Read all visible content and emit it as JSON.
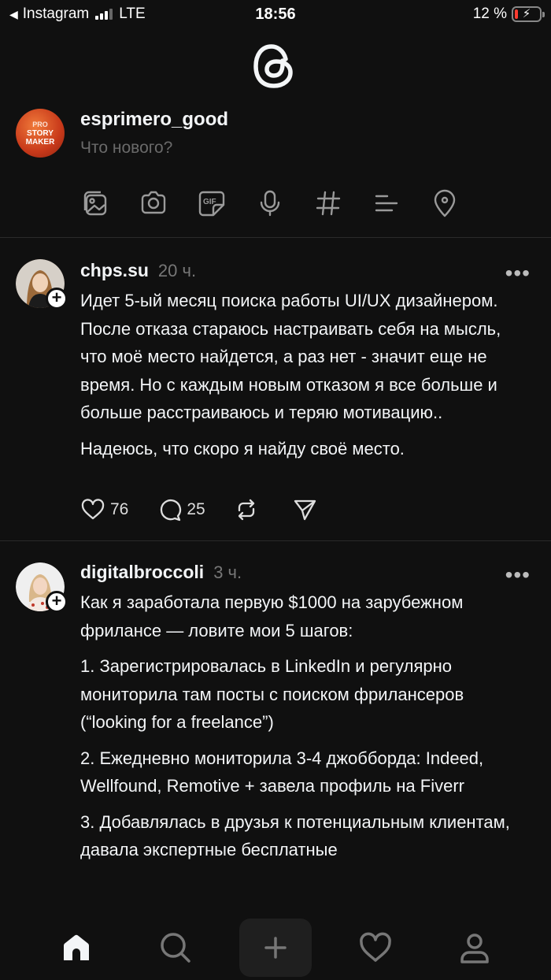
{
  "status_bar": {
    "back_label": "Instagram",
    "network": "LTE",
    "time": "18:56",
    "battery": "12 %",
    "battery_level": 0.12,
    "battery_color": "#ff3b30"
  },
  "composer": {
    "avatar_text": [
      "PRO",
      "STORY",
      "MAKER"
    ],
    "username": "esprimero_good",
    "placeholder": "Что нового?",
    "tools": [
      "image-icon",
      "camera-icon",
      "gif-icon",
      "microphone-icon",
      "hashtag-icon",
      "list-icon",
      "location-pin-icon"
    ]
  },
  "posts": [
    {
      "username": "chps.su",
      "time": "20 ч.",
      "paragraphs": [
        "Идет 5-ый месяц поиска работы UI/UX дизайнером. После отказа стараюсь настраивать себя на мысль, что моё место найдется, а раз нет - значит еще не время. Но с каждым новым отказом я все больше и больше расстраиваюсь и теряю мотивацию..",
        "Надеюсь, что скоро я найду своё место."
      ],
      "likes": "76",
      "replies": "25"
    },
    {
      "username": "digitalbroccoli",
      "time": "3 ч.",
      "paragraphs": [
        "Как я заработала первую $1000 на зарубежном фрилансе — ловите мои 5 шагов:",
        "1. Зарегистрировалась в LinkedIn и регулярно мониторила там посты с поиском фрилансеров (“looking for a freelance”)",
        "2. Ежедневно мониторила 3-4 джобборда: Indeed, Wellfound, Remotive + завела профиль на Fiverr",
        "3. Добавлялась в друзья к потенциальным клиентам, давала экспертные бесплатные"
      ]
    }
  ],
  "nav": [
    "home-icon",
    "search-icon",
    "new-post-icon",
    "activity-heart-icon",
    "profile-icon"
  ]
}
